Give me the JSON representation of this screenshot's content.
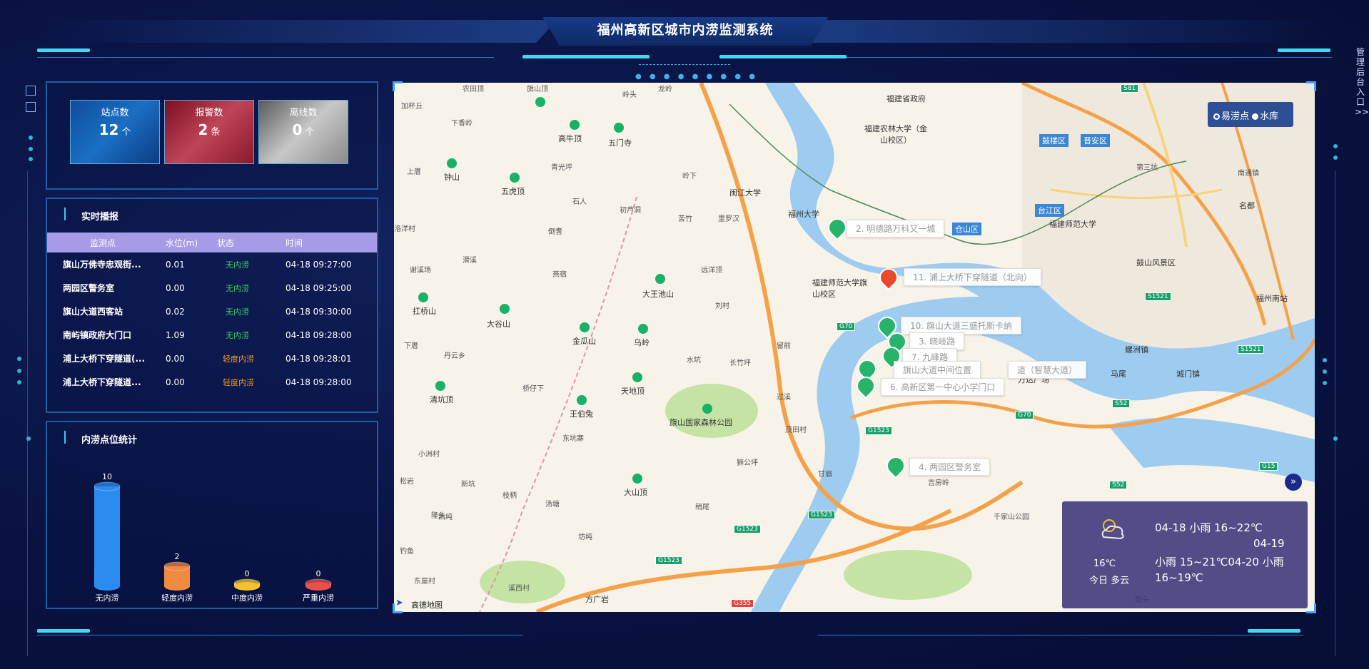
{
  "header": {
    "title": "福州高新区城市内涝监测系统",
    "admin_link": "管理后台入口>>"
  },
  "stats": [
    {
      "label": "站点数",
      "value": "12",
      "unit": "个"
    },
    {
      "label": "报警数",
      "value": "2",
      "unit": "条"
    },
    {
      "label": "离线数",
      "value": "0",
      "unit": "个"
    }
  ],
  "realtime": {
    "title": "实时播报",
    "columns": [
      "监测点",
      "水位(m)",
      "状态",
      "时间"
    ],
    "rows": [
      {
        "name": "旗山万佛寺忠观街...",
        "level": "0.01",
        "status": "无内涝",
        "time": "04-18 09:27:00"
      },
      {
        "name": "两园区警务室",
        "level": "0.00",
        "status": "无内涝",
        "time": "04-18 09:25:00"
      },
      {
        "name": "旗山大道西客站",
        "level": "0.02",
        "status": "无内涝",
        "time": "04-18 09:30:00"
      },
      {
        "name": "南屿镇政府大门口",
        "level": "1.09",
        "status": "无内涝",
        "time": "04-18 09:28:00"
      },
      {
        "name": "浦上大桥下穿隧道(...",
        "level": "0.00",
        "status": "轻度内涝",
        "time": "04-18 09:28:01"
      },
      {
        "name": "浦上大桥下穿隧道...",
        "level": "0.00",
        "status": "轻度内涝",
        "time": "04-18 09:28:00"
      }
    ]
  },
  "waterlog_stats": {
    "title": "内涝点位统计",
    "chart_data": {
      "type": "bar",
      "categories": [
        "无内涝",
        "轻度内涝",
        "中度内涝",
        "严重内涝"
      ],
      "values": [
        10,
        2,
        0,
        0
      ],
      "colors": [
        "#2b8cf0",
        "#f08a40",
        "#f2c230",
        "#e8504a"
      ]
    }
  },
  "map": {
    "legend": {
      "option1": "易涝点",
      "option2": "水库"
    },
    "attribution": "高德地图",
    "markers": [
      "2. 明德路万科又一城",
      "11. 浦上大桥下穿隧道（北向）",
      "10. 旗山大道三盛托斯卡纳",
      "3. 晓岐路",
      "7. 九峰路",
      "旗山大道中间位置",
      "道（智慧大道）",
      "6. 高新区第一中心小学门口",
      "4. 两园区警务室"
    ],
    "places": [
      "农田顶",
      "旗山顶",
      "岭头",
      "龙岭",
      "加杯丘",
      "下香岭",
      "高牛顶",
      "五门寺",
      "青光坪",
      "钟山",
      "五虎顶",
      "石人",
      "初芦洞",
      "岭下",
      "闽江大学",
      "福州大学",
      "上厝",
      "洛洋村",
      "倒耆",
      "燕宿",
      "苦竹",
      "里罗汉",
      "远洋顶",
      "大王池山",
      "刘村",
      "谢溪场",
      "滑溪",
      "扛桥山",
      "大谷山",
      "金瓜山",
      "乌岭",
      "丹云乡",
      "下厝",
      "水坑",
      "长竹坪",
      "留前",
      "清坑顶",
      "桥仔下",
      "天地顶",
      "王伯兔",
      "旗山国家森林公园",
      "过溪",
      "东坑寨",
      "茂田村",
      "小洲村",
      "松岩",
      "新坑",
      "枝柄",
      "汤塘",
      "大山顶",
      "狮公坪",
      "稍尾",
      "隆头",
      "甘眉",
      "钓鱼",
      "东屋村",
      "凯纯",
      "坊纯",
      "溪西村",
      "方广岩",
      "福建省政府",
      "福建农林大学（金山校区）",
      "福建师范大学旗山校区",
      "仓山区",
      "鼓楼区",
      "晋安区",
      "台江区",
      "万达广场",
      "福建师范大学",
      "鼓山风景区",
      "名都",
      "福州南站",
      "城门镇",
      "螺洲镇",
      "马尾",
      "第三坑",
      "南通镇",
      "吉房岭",
      "千家山公园",
      "鼓头"
    ],
    "districts": [
      "鼓楼区",
      "晋安区",
      "台江区",
      "仓山区"
    ],
    "roads": [
      "S81",
      "S1521",
      "S1521",
      "G70",
      "G70",
      "S52",
      "G1523",
      "G1523",
      "G1523",
      "G1523",
      "G355",
      "S52",
      "G15"
    ]
  },
  "weather": {
    "today_temp": "16℃",
    "today_desc": "今日 多云",
    "forecast_line1": "04-18 小雨  16~22℃",
    "forecast_line2": "04-19",
    "forecast_line3": "小雨  15~21℃04-20 小雨",
    "forecast_line4": "16~19℃"
  }
}
